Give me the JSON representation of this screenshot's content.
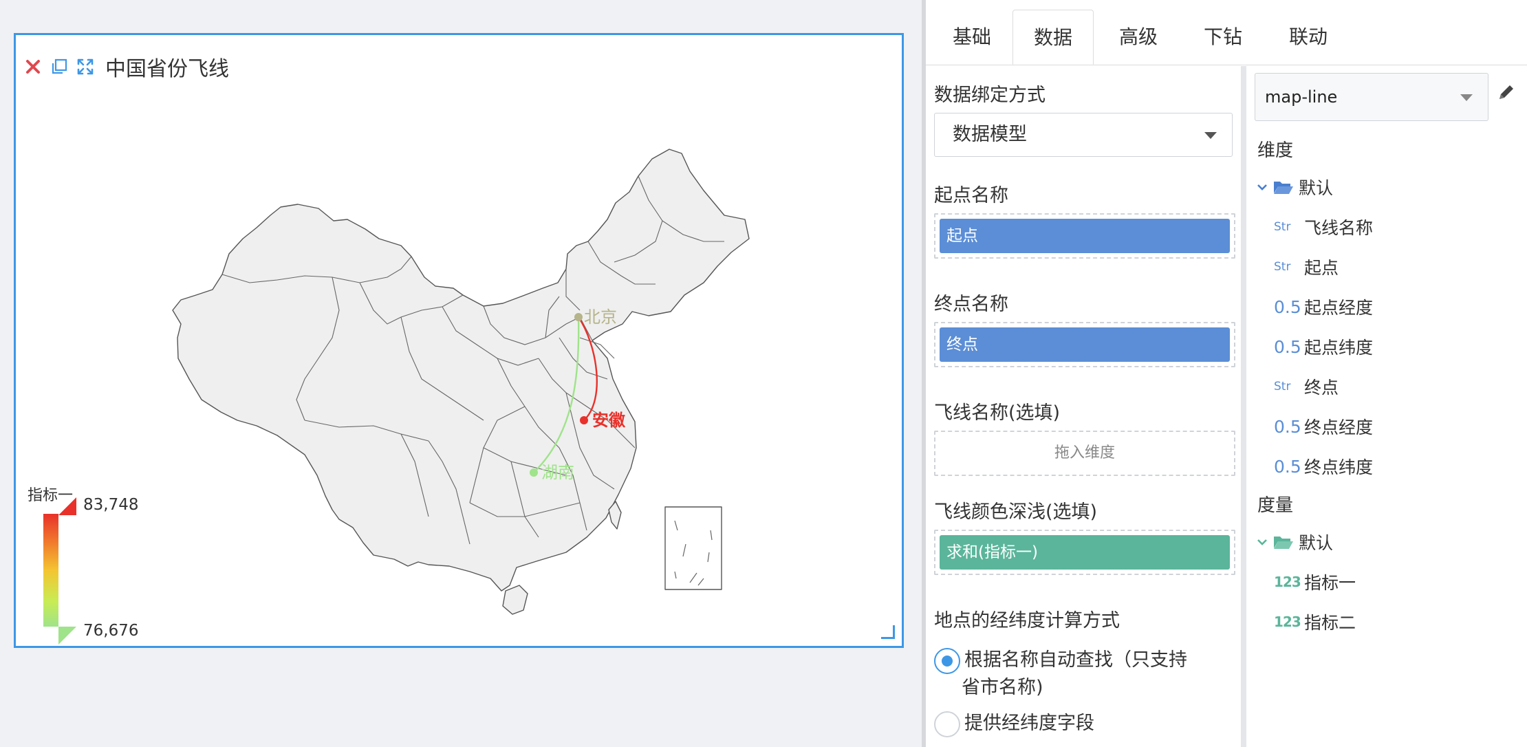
{
  "widget": {
    "title": "中国省份飞线",
    "toolbar": {
      "close_icon": "close-icon",
      "copy_icon": "copy-icon",
      "expand_icon": "expand-icon"
    },
    "map_labels": {
      "beijing": "北京",
      "anhui": "安徽",
      "hunan": "湖南"
    },
    "legend": {
      "title": "指标一",
      "max": "83,748",
      "min": "76,676"
    },
    "colors": {
      "line_red": "#e8312a",
      "line_green": "#9fe38a",
      "label_beijing": "#b5b48a",
      "accent": "#3d97e6"
    }
  },
  "panel": {
    "tabs": [
      {
        "label": "基础"
      },
      {
        "label": "数据"
      },
      {
        "label": "高级"
      },
      {
        "label": "下钻"
      },
      {
        "label": "联动"
      }
    ],
    "active_tab": "数据",
    "binding": {
      "label": "数据绑定方式",
      "value": "数据模型"
    },
    "start_name": {
      "label": "起点名称",
      "chip": "起点"
    },
    "end_name": {
      "label": "终点名称",
      "chip": "终点"
    },
    "line_name": {
      "label": "飞线名称(选填)",
      "placeholder": "拖入维度"
    },
    "line_color": {
      "label": "飞线颜色深浅(选填)",
      "chip": "求和(指标一)"
    },
    "latlng": {
      "label": "地点的经纬度计算方式",
      "option1_line1": "根据名称自动查找（只支持",
      "option1_line2": "省市名称)",
      "option2": "提供经纬度字段"
    },
    "dataset": {
      "selected": "map-line",
      "dimensions_label": "维度",
      "dim_folder": "默认",
      "dimensions": [
        {
          "tag": "Str",
          "name": "飞线名称"
        },
        {
          "tag": "Str",
          "name": "起点"
        },
        {
          "tag": "0.5",
          "name": "起点经度"
        },
        {
          "tag": "0.5",
          "name": "起点纬度"
        },
        {
          "tag": "Str",
          "name": "终点"
        },
        {
          "tag": "0.5",
          "name": "终点经度"
        },
        {
          "tag": "0.5",
          "name": "终点纬度"
        }
      ],
      "measures_label": "度量",
      "mea_folder": "默认",
      "measures": [
        {
          "tag": "123",
          "name": "指标一"
        },
        {
          "tag": "123",
          "name": "指标二"
        }
      ]
    }
  }
}
